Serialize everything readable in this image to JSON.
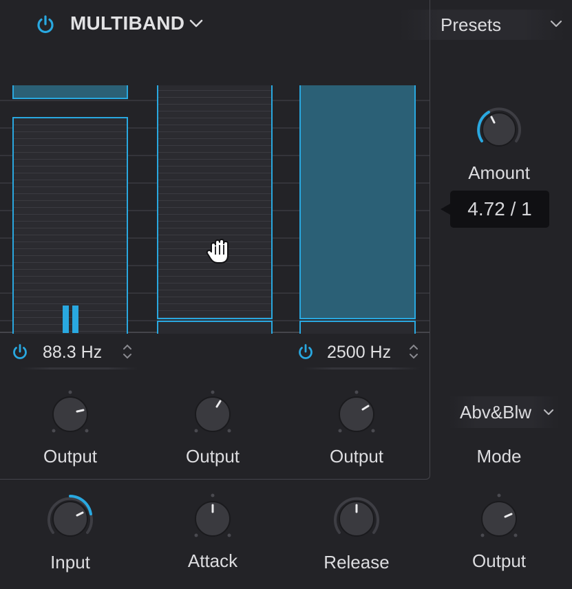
{
  "header": {
    "title": "MULTIBAND",
    "presets_label": "Presets"
  },
  "bands": {
    "low_freq": "88.3 Hz",
    "high_freq": "2500 Hz",
    "output_labels": [
      "Output",
      "Output",
      "Output"
    ]
  },
  "amount": {
    "label": "Amount",
    "tooltip": "4.72 / 1"
  },
  "mode": {
    "value": "Abv&Blw",
    "label": "Mode"
  },
  "bottom_knobs": {
    "input_label": "Input",
    "attack_label": "Attack",
    "release_label": "Release",
    "output_label": "Output"
  },
  "colors": {
    "accent": "#29a8e0",
    "background": "#232327",
    "band_fill": "#2b6076",
    "knob_body": "#3a3a3f"
  }
}
